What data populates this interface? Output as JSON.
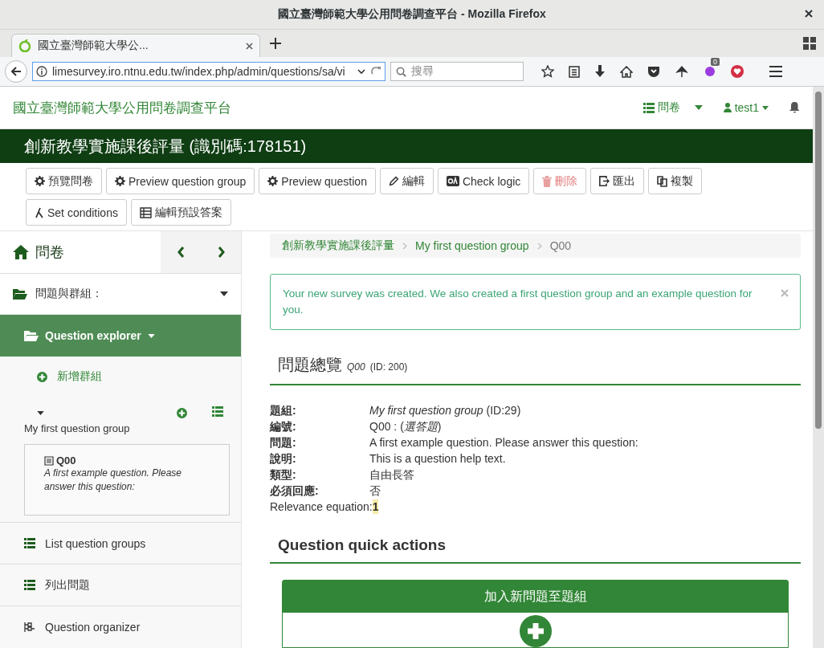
{
  "browser": {
    "title": "國立臺灣師範大學公用問卷調查平台 - Mozilla Firefox",
    "tab_title": "國立臺灣師範大學公...",
    "url": "limesurvey.iro.ntnu.edu.tw/index.php/admin/questions/sa/vi",
    "search_placeholder": "搜尋",
    "badge": "0"
  },
  "navbar": {
    "brand": "國立臺灣師範大學公用問卷調查平台",
    "menu_label": "問卷",
    "user": "test1"
  },
  "survey_title": "創新教學實施課後評量 (識別碼:178151)",
  "toolbar": [
    {
      "label": "預覽問卷",
      "kind": "gear",
      "disabled": false
    },
    {
      "label": "Preview question group",
      "kind": "gear",
      "disabled": false
    },
    {
      "label": "Preview question",
      "kind": "gear",
      "disabled": false
    },
    {
      "label": "編輯",
      "kind": "pencil",
      "disabled": false
    },
    {
      "label": "Check logic",
      "kind": "qa",
      "disabled": false
    },
    {
      "label": "刪除",
      "kind": "trash",
      "disabled": true
    },
    {
      "label": "匯出",
      "kind": "export",
      "disabled": false
    },
    {
      "label": "複製",
      "kind": "copy",
      "disabled": false
    },
    {
      "label": "Set conditions",
      "kind": "fork",
      "disabled": false
    },
    {
      "label": "編輯預設答案",
      "kind": "table",
      "disabled": false
    }
  ],
  "sidebar": {
    "title": "問卷",
    "section": "問題與群組：",
    "explorer": {
      "label": "Question explorer",
      "selected": true
    },
    "add_group": "新增群組",
    "group": {
      "name": "My first question group",
      "expanded": true,
      "questions": [
        {
          "code": "Q00",
          "text": "A first example question. Please answer this question:"
        }
      ]
    },
    "links": [
      {
        "label": "List question groups",
        "kind": "list"
      },
      {
        "label": "列出問題",
        "kind": "list"
      },
      {
        "label": "Question organizer",
        "kind": "tree"
      }
    ]
  },
  "breadcrumb": [
    {
      "label": "創新教學實施課後評量",
      "link": true
    },
    {
      "label": "My first question group",
      "link": true
    },
    {
      "label": "Q00",
      "link": false
    }
  ],
  "alert": "Your new survey was created. We also created a first question group and an example question for you.",
  "overview": {
    "heading": "問題總覽",
    "code": "Q00",
    "id": "(ID: 200)",
    "rows": [
      {
        "kind": "field",
        "label": "題組:",
        "value": "*My first question group* (ID:29)"
      },
      {
        "kind": "field",
        "label": "編號:",
        "value": "Q00 : (*選答題*)"
      },
      {
        "kind": "field",
        "label": "問題:",
        "value": "A first example question. Please answer this question:"
      },
      {
        "kind": "field",
        "label": "說明:",
        "value": "This is a question help text."
      },
      {
        "kind": "field",
        "label": "類型:",
        "value": "自由長答"
      },
      {
        "kind": "field",
        "label": "必須回應:",
        "value": "否"
      },
      {
        "kind": "relevance",
        "label": "Relevance equation:",
        "value": "1"
      }
    ]
  },
  "quick_actions": {
    "heading": "Question quick actions",
    "panel_title": "加入新問題至題組"
  }
}
